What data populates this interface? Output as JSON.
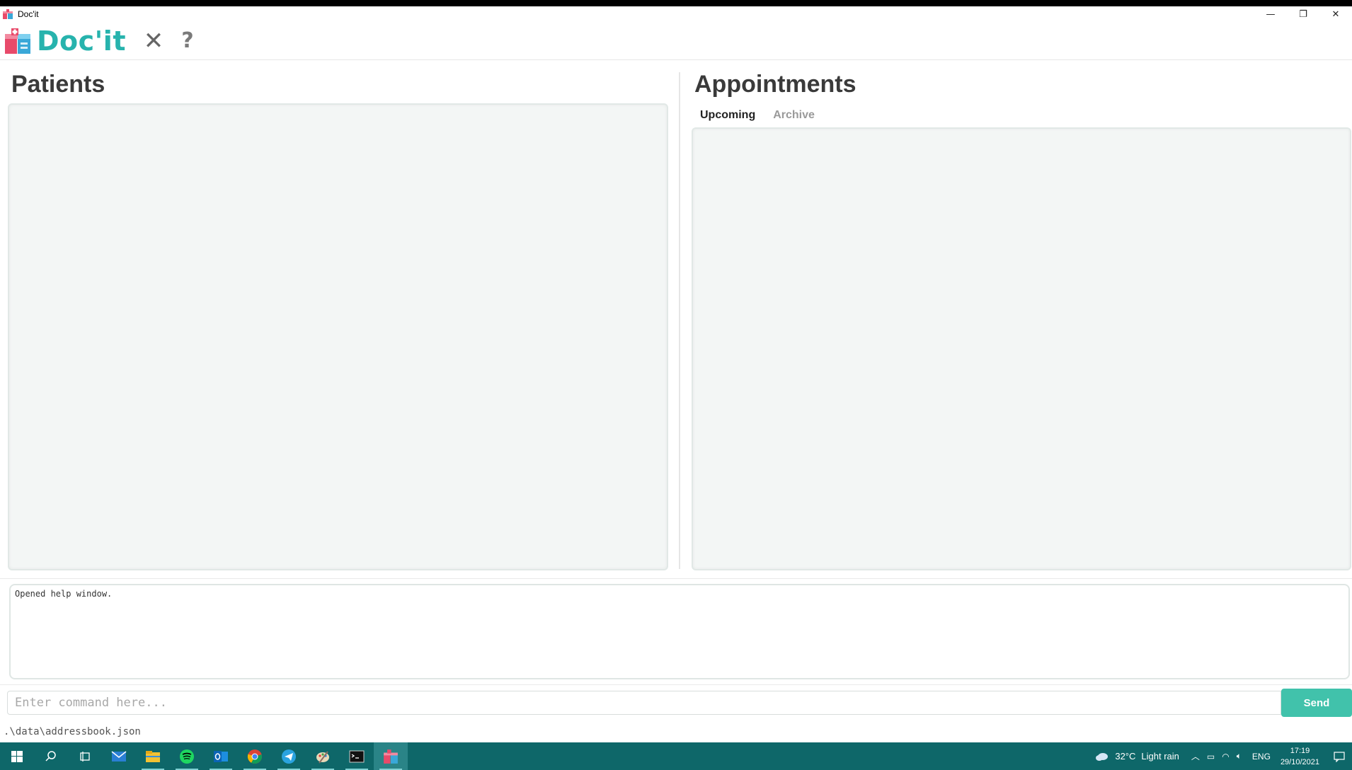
{
  "window": {
    "title": "Doc'it",
    "minimize_glyph": "—",
    "restore_glyph": "❐",
    "close_glyph": "✕"
  },
  "toolbar": {
    "logo_text": "Doc'it",
    "exit_glyph": "✕",
    "help_glyph": "?"
  },
  "patients": {
    "title": "Patients"
  },
  "appointments": {
    "title": "Appointments",
    "tabs": [
      {
        "label": "Upcoming",
        "active": true
      },
      {
        "label": "Archive",
        "active": false
      }
    ]
  },
  "result": {
    "text": "Opened help window."
  },
  "command": {
    "placeholder": "Enter command here...",
    "value": "",
    "send_label": "Send"
  },
  "status": {
    "path": ".\\data\\addressbook.json"
  },
  "taskbar": {
    "apps": [
      "windows-start",
      "search",
      "task-view",
      "mail",
      "file-explorer",
      "spotify",
      "outlook",
      "chrome",
      "telegram",
      "paint",
      "terminal",
      "docit"
    ],
    "tray": {
      "temperature": "32°C",
      "weather": "Light rain",
      "language": "ENG",
      "time": "17:19",
      "date": "29/10/2021"
    }
  },
  "colors": {
    "accent": "#41c2ab",
    "logo": "#27b3ad",
    "taskbar": "#0e6769",
    "panel_bg": "#f3f6f5"
  }
}
